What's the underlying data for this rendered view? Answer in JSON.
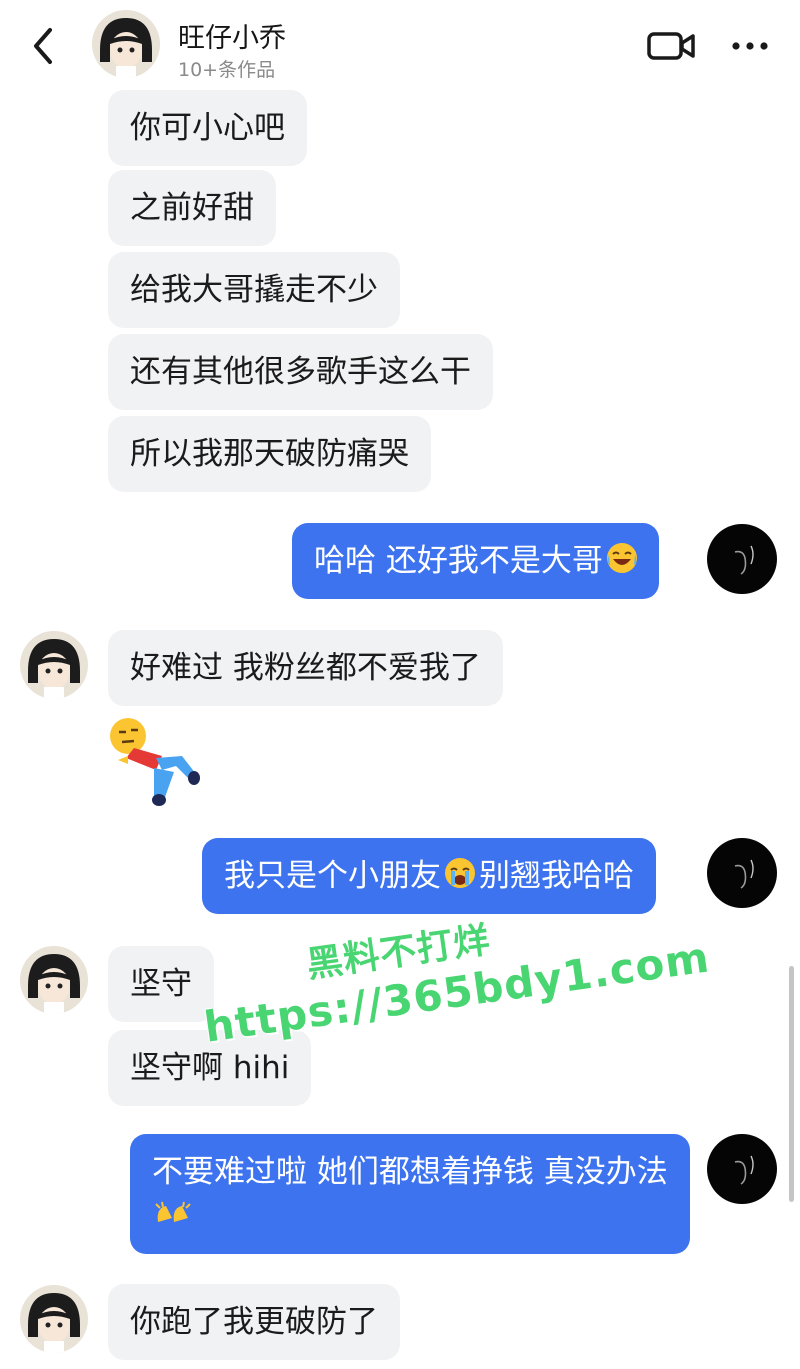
{
  "header": {
    "title": "旺仔小乔",
    "subtitle": "10+条作品",
    "back_icon": "chevron-left-icon",
    "video_icon": "video-call-icon",
    "more_icon": "more-dots-icon"
  },
  "messages": [
    {
      "side": "in",
      "text": "你可小心吧"
    },
    {
      "side": "in",
      "text": "之前好甜"
    },
    {
      "side": "in",
      "text": "给我大哥撬走不少"
    },
    {
      "side": "in",
      "text": "还有其他很多歌手这么干"
    },
    {
      "side": "in",
      "text": "所以我那天破防痛哭"
    },
    {
      "side": "out",
      "text": "哈哈 还好我不是大哥",
      "emoji": "laugh-cry-emoji"
    },
    {
      "side": "in",
      "text": "好难过 我粉丝都不爱我了"
    },
    {
      "side": "in",
      "sticker": "lying-down-sticker"
    },
    {
      "side": "out",
      "text_before": "我只是个小朋友",
      "emoji": "crying-emoji",
      "text_after": "别翘我哈哈"
    },
    {
      "side": "in",
      "text": "坚守"
    },
    {
      "side": "in",
      "text": "坚守啊 hihi"
    },
    {
      "side": "out",
      "text": "不要难过啦 她们都想着挣钱 真没办法",
      "emoji": "clapping-hands-emoji"
    },
    {
      "side": "in",
      "text": "你跑了我更破防了"
    }
  ],
  "watermark": {
    "line1": "黑料不打烊",
    "line2": "https://365bdy1.com"
  },
  "colors": {
    "outgoing_bubble": "#3d73ee",
    "incoming_bubble": "#f1f2f4",
    "watermark": "#3fd36b"
  }
}
